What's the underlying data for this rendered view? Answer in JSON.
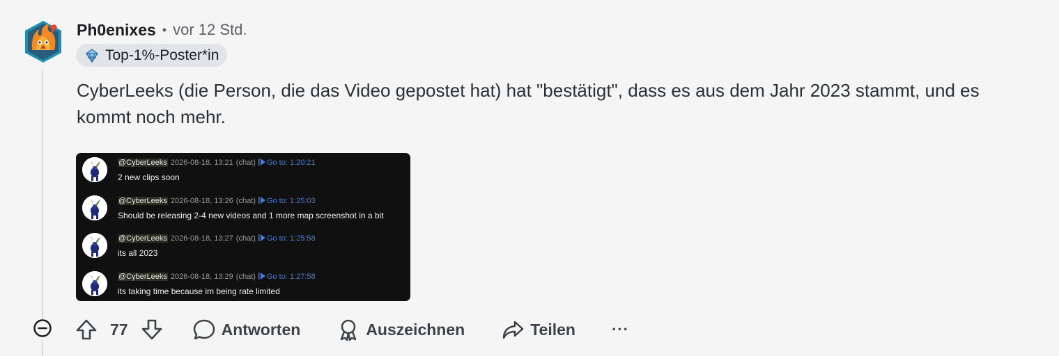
{
  "comment": {
    "username": "Ph0enixes",
    "separator": "•",
    "time": "vor 12 Std.",
    "flair": "Top-1%-Poster*in",
    "body": "CyberLeeks (die Person, die das Video gepostet hat) hat \"bestätigt\", dass es aus dem Jahr 2023 stammt, und es kommt noch mehr.",
    "votes": "77"
  },
  "screenshot": {
    "messages": [
      {
        "user": "@CyberLeeks",
        "date": "2026-08-18, 13:21",
        "type": "(chat)",
        "goto": "Go to: 1:20:21",
        "text": "2 new clips soon"
      },
      {
        "user": "@CyberLeeks",
        "date": "2026-08-18, 13:26",
        "type": "(chat)",
        "goto": "Go to: 1:25:03",
        "text": "Should be releasing 2-4 new videos and 1 more map screenshot in a bit"
      },
      {
        "user": "@CyberLeeks",
        "date": "2026-08-18, 13:27",
        "type": "(chat)",
        "goto": "Go to: 1:25:58",
        "text": "its all 2023"
      },
      {
        "user": "@CyberLeeks",
        "date": "2026-08-18, 13:29",
        "type": "(chat)",
        "goto": "Go to: 1:27:58",
        "text": "its taking time because im being rate limited"
      }
    ]
  },
  "actions": {
    "reply": "Antworten",
    "award": "Auszeichnen",
    "share": "Teilen",
    "more": "···"
  },
  "icons": {
    "collapse": "minus-circle-icon",
    "upvote": "arrow-up-icon",
    "downvote": "arrow-down-icon",
    "reply": "speech-bubble-icon",
    "award": "award-ribbon-icon",
    "share": "share-arrow-icon",
    "more": "more-dots-icon"
  },
  "colors": {
    "background": "#f5f5f6",
    "text": "#2a3136",
    "muted": "#5c6166",
    "flair_bg": "#e1e4e8",
    "goto_link": "#4a7bd1"
  }
}
